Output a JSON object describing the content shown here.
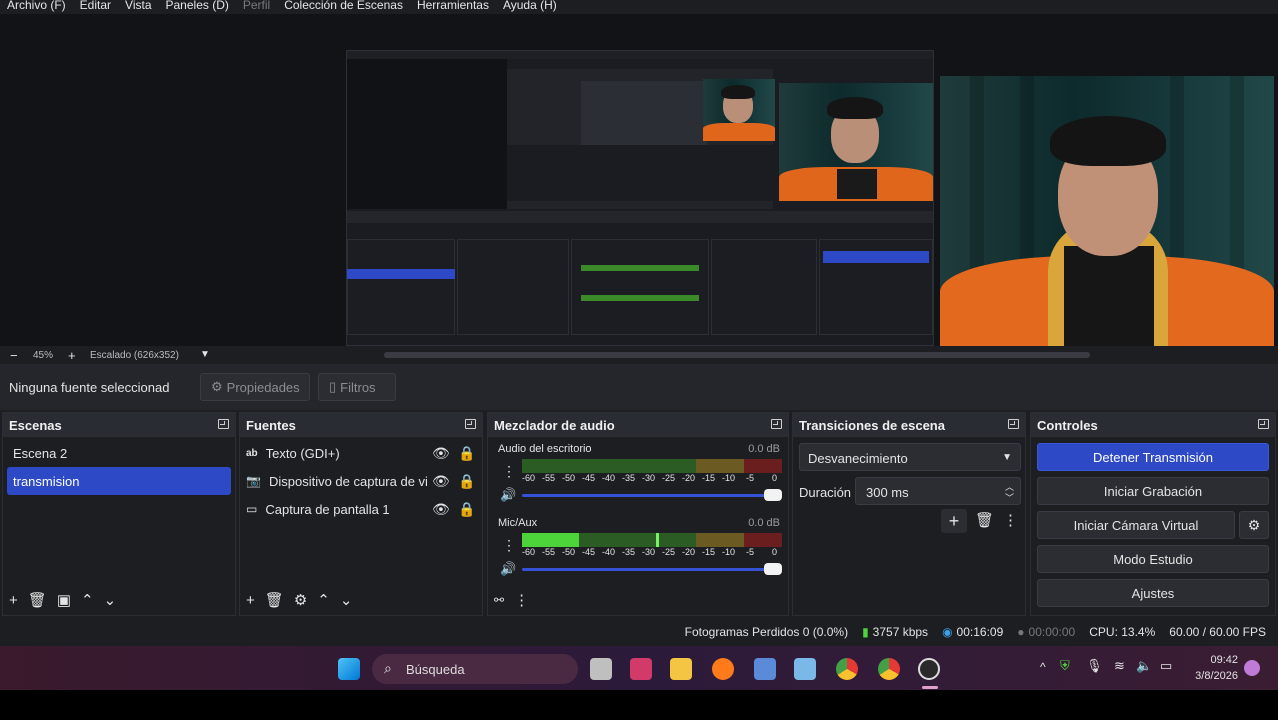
{
  "menu": [
    "Archivo (F)",
    "Editar",
    "Vista",
    "Paneles (D)",
    "Perfil",
    "Colección de Escenas",
    "Herramientas",
    "Ayuda (H)"
  ],
  "menu_disabled_index": 4,
  "zoom": {
    "value": "45%",
    "scale_label": "Escalado (626x352)"
  },
  "props_bar": {
    "status": "Ninguna fuente seleccionad",
    "properties_label": "Propiedades",
    "filters_label": "Filtros"
  },
  "scenes": {
    "title": "Escenas",
    "items": [
      "Escena 2",
      "transmision"
    ],
    "selected_index": 1
  },
  "sources": {
    "title": "Fuentes",
    "items": [
      {
        "icon": "text-icon",
        "label": "Texto (GDI+)"
      },
      {
        "icon": "camera-icon",
        "label": "Dispositivo de captura de vid"
      },
      {
        "icon": "monitor-icon",
        "label": "Captura de pantalla 1"
      }
    ]
  },
  "mixer": {
    "title": "Mezclador de audio",
    "channels": [
      {
        "name": "Audio del escritorio",
        "db": "0.0 dB",
        "level": 0.0,
        "volume": 1.0
      },
      {
        "name": "Mic/Aux",
        "db": "0.0 dB",
        "level": 0.22,
        "volume": 1.0
      }
    ],
    "ticks": [
      "-60",
      "-55",
      "-50",
      "-45",
      "-40",
      "-35",
      "-30",
      "-25",
      "-20",
      "-15",
      "-10",
      "-5",
      "0"
    ]
  },
  "transitions": {
    "title": "Transiciones de escena",
    "selected": "Desvanecimiento",
    "duration_label": "Duración",
    "duration_value": "300 ms"
  },
  "controls": {
    "title": "Controles",
    "buttons": [
      "Detener Transmisión",
      "Iniciar Grabación",
      "Iniciar Cámara Virtual",
      "Modo Estudio",
      "Ajustes"
    ]
  },
  "status": {
    "dropped": "Fotogramas Perdidos 0 (0.0%)",
    "bitrate": "3757 kbps",
    "stream_time": "00:16:09",
    "rec_time": "00:00:00",
    "cpu": "CPU: 13.4%",
    "fps": "60.00 / 60.00 FPS"
  },
  "taskbar": {
    "search_placeholder": "Búsqueda",
    "time": "09:42",
    "date": "3/8/2026"
  },
  "colors": {
    "accent": "#2e49c5",
    "meter_green": "#4cd43a",
    "meter_yellow": "#c9a52a",
    "meter_red": "#b52a2a"
  }
}
